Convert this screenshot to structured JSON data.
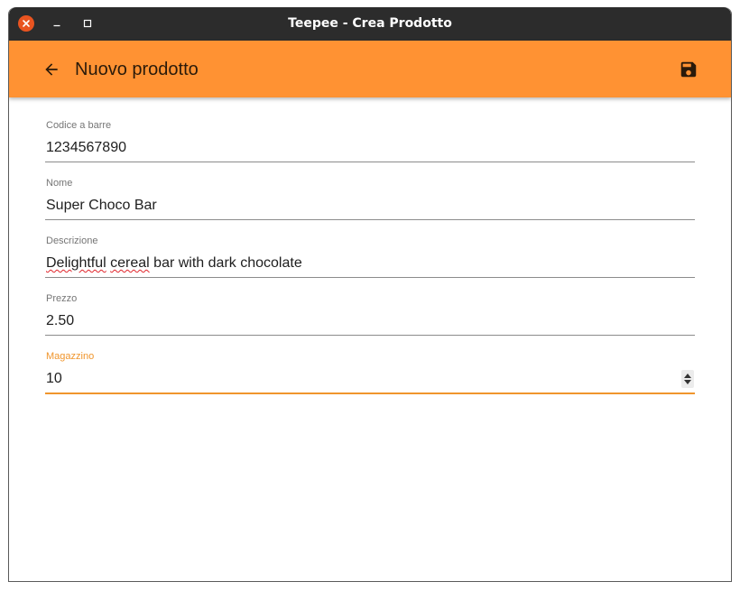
{
  "window": {
    "title": "Teepee - Crea Prodotto",
    "controls": [
      "close-icon",
      "minimize-icon",
      "maximize-icon"
    ]
  },
  "appbar": {
    "title": "Nuovo prodotto",
    "back_icon": "arrow-left-icon",
    "save_icon": "floppy-disk-icon",
    "color": "#ff9233"
  },
  "form": {
    "barcode": {
      "label": "Codice a barre",
      "value": "1234567890"
    },
    "name": {
      "label": "Nome",
      "value": "Super Choco Bar"
    },
    "description": {
      "label": "Descrizione",
      "value_parts": [
        "Delightful",
        " ",
        "cereal",
        " bar with dark chocolate"
      ]
    },
    "price": {
      "label": "Prezzo",
      "value": "2.50"
    },
    "stock": {
      "label": "Magazzino",
      "value": "10",
      "focused": true
    }
  },
  "colors": {
    "accent": "#f0952c",
    "close_button": "#e95420",
    "titlebar": "#2c2c2c"
  }
}
